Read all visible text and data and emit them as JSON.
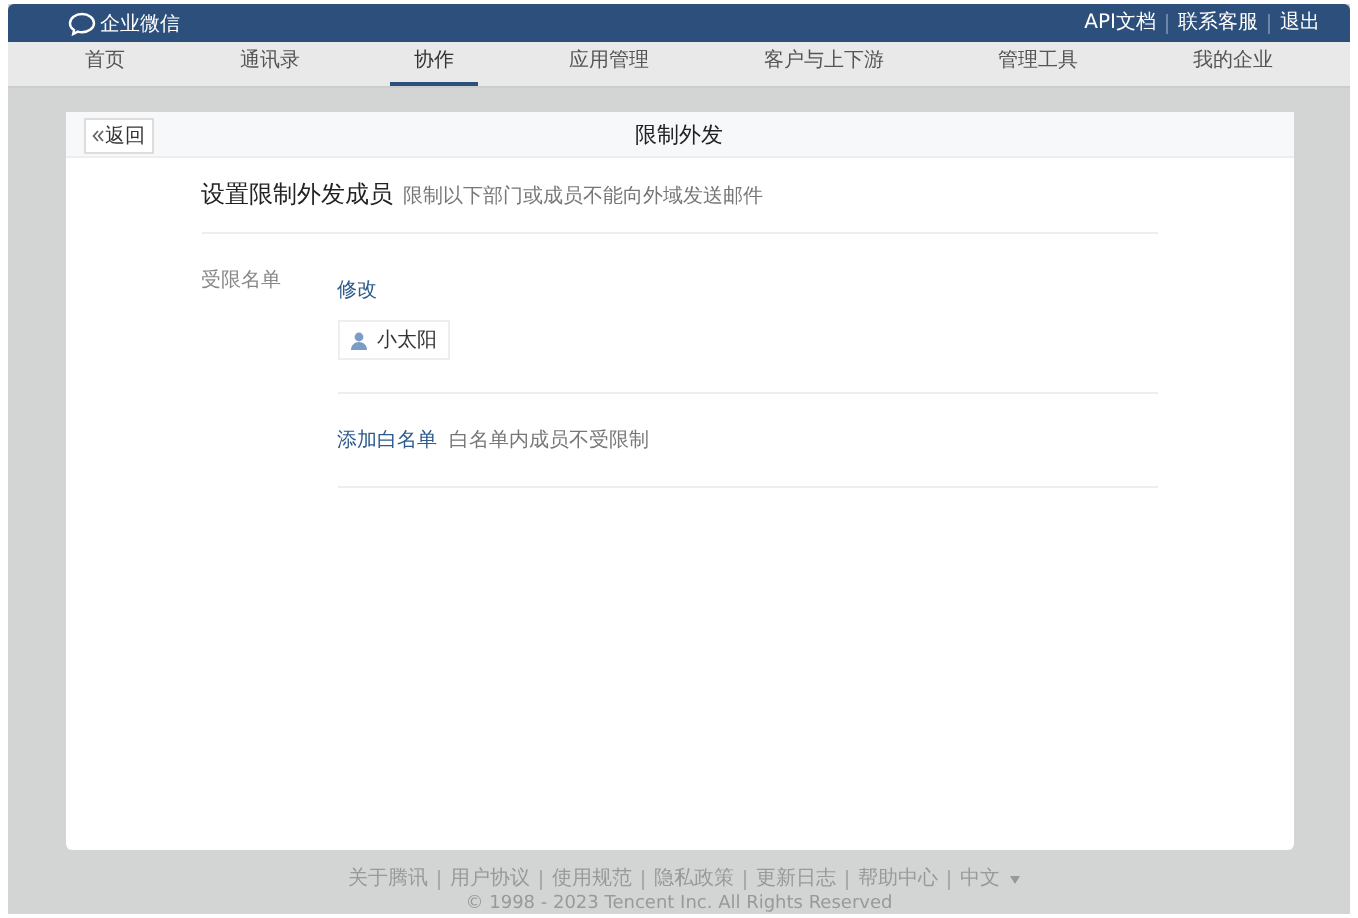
{
  "header": {
    "logo_text": "企业微信",
    "links": [
      "API文档",
      "联系客服",
      "退出"
    ]
  },
  "nav": [
    {
      "label": "首页",
      "selected": false
    },
    {
      "label": "通讯录",
      "selected": false
    },
    {
      "label": "协作",
      "selected": true
    },
    {
      "label": "应用管理",
      "selected": false
    },
    {
      "label": "客户与上下游",
      "selected": false
    },
    {
      "label": "管理工具",
      "selected": false
    },
    {
      "label": "我的企业",
      "selected": false
    }
  ],
  "card": {
    "back_button": "返回",
    "title": "限制外发",
    "section_title": "设置限制外发成员",
    "section_hint": "限制以下部门或成员不能向外域发送邮件",
    "restricted_label": "受限名单",
    "modify_link": "修改",
    "members": [
      "小太阳"
    ],
    "whitelist_link": "添加白名单",
    "whitelist_hint": "白名单内成员不受限制"
  },
  "footer": {
    "links": [
      "关于腾讯",
      "用户协议",
      "使用规范",
      "隐私政策",
      "更新日志",
      "帮助中心",
      "中文"
    ],
    "copyright": "© 1998 - 2023 Tencent Inc. All Rights Reserved"
  }
}
